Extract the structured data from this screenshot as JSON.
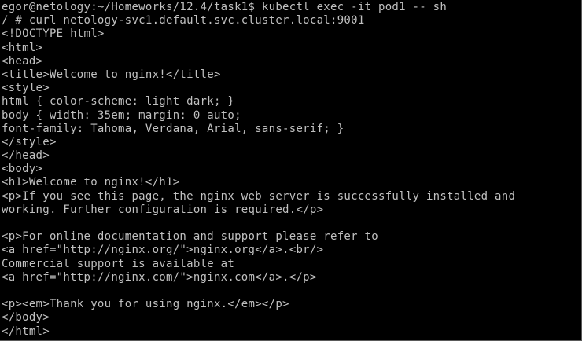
{
  "terminal": {
    "prompt_line": "egor@netology:~/Homeworks/12.4/task1$ kubectl exec -it pod1 -- sh",
    "command_line": "/ # curl netology-svc1.default.svc.cluster.local:9001",
    "output": [
      "<!DOCTYPE html>",
      "<html>",
      "<head>",
      "<title>Welcome to nginx!</title>",
      "<style>",
      "html { color-scheme: light dark; }",
      "body { width: 35em; margin: 0 auto;",
      "font-family: Tahoma, Verdana, Arial, sans-serif; }",
      "</style>",
      "</head>",
      "<body>",
      "<h1>Welcome to nginx!</h1>",
      "<p>If you see this page, the nginx web server is successfully installed and",
      "working. Further configuration is required.</p>",
      "",
      "<p>For online documentation and support please refer to",
      "<a href=\"http://nginx.org/\">nginx.org</a>.<br/>",
      "Commercial support is available at",
      "<a href=\"http://nginx.com/\">nginx.com</a>.</p>",
      "",
      "<p><em>Thank you for using nginx.</em></p>",
      "</body>",
      "</html>"
    ]
  }
}
